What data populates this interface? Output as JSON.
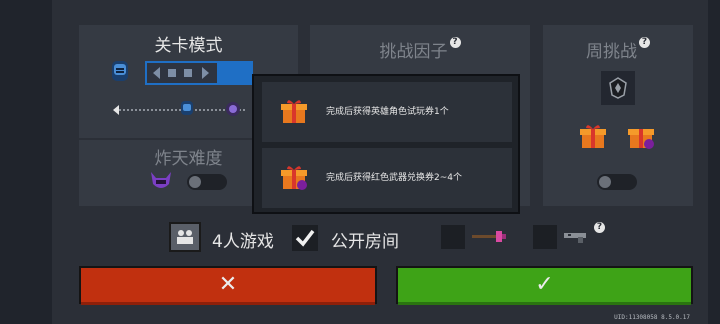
{
  "mode_panel": {
    "title": "关卡模式",
    "hard_mode_label": "炸天难度"
  },
  "challenge_panel": {
    "title": "挑战因子",
    "help_icon": "?"
  },
  "weekly_panel": {
    "title": "周挑战",
    "help_icon": "?"
  },
  "rewards_popup": {
    "rewards": [
      {
        "text": "完成后获得英雄角色试玩券1个",
        "icon": "gift-box-icon"
      },
      {
        "text": "完成后获得红色武器兑换券2~4个",
        "icon": "gift-box-badge-icon"
      }
    ]
  },
  "options": {
    "players_label": "4人游戏",
    "public_room_label": "公开房间",
    "public_room_checked": true,
    "weapon_help_icon": "?"
  },
  "buttons": {
    "cancel_icon": "✕",
    "confirm_icon": "✓"
  },
  "footer": {
    "uid_version": "UID:11308058 8.5.0.17"
  },
  "colors": {
    "cancel": "#c1300f",
    "confirm": "#3ea317",
    "accent_blue": "#1f6fc5"
  }
}
